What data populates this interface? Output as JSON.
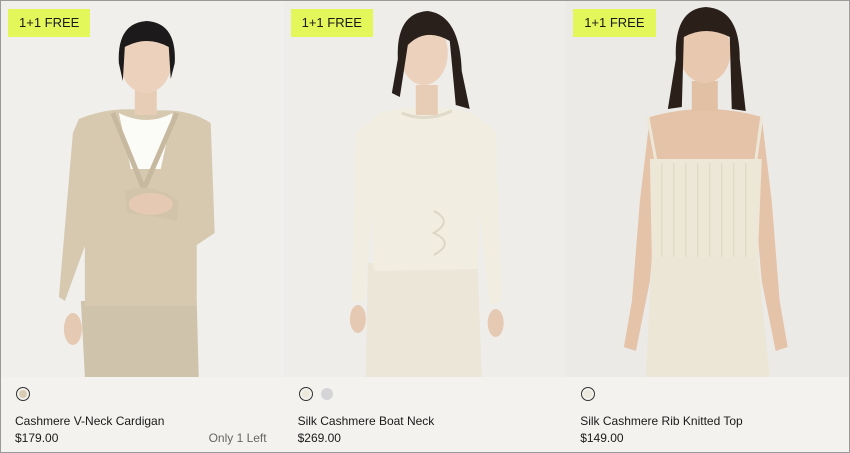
{
  "products": [
    {
      "badge": "1+1 FREE",
      "name": "Cashmere V-Neck Cardigan",
      "price": "$179.00",
      "stock_note": "Only 1 Left",
      "colors": [
        {
          "hex": "#d8ccb4",
          "selected": true
        }
      ],
      "image": "woman-in-beige-cardigan"
    },
    {
      "badge": "1+1 FREE",
      "name": "Silk Cashmere Boat Neck",
      "price": "$269.00",
      "stock_note": "",
      "colors": [
        {
          "hex": "#ece8dc",
          "selected": true
        },
        {
          "hex": "#d5d5d8",
          "selected": false
        }
      ],
      "image": "woman-in-cream-long-sleeve-top"
    },
    {
      "badge": "1+1 FREE",
      "name": "Silk Cashmere Rib Knitted Top",
      "price": "$149.00",
      "stock_note": "",
      "colors": [
        {
          "hex": "#ece8dc",
          "selected": true
        }
      ],
      "image": "woman-in-cream-rib-camisole"
    }
  ]
}
